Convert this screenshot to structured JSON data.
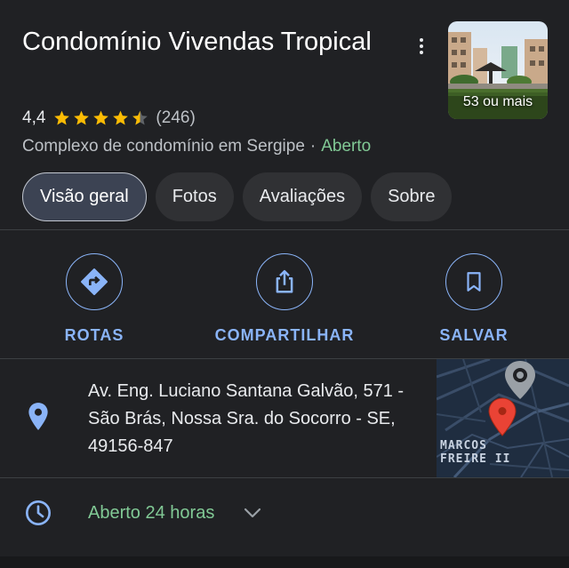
{
  "place": {
    "title": "Condomínio Vivendas Tropical",
    "rating": "4,4",
    "stars_filled": 4.4,
    "review_count": "(246)",
    "category": "Complexo de condomínio em Sergipe",
    "separator": "·",
    "status": "Aberto",
    "photo_label": "53 ou mais"
  },
  "tabs": [
    {
      "label": "Visão geral",
      "active": true
    },
    {
      "label": "Fotos",
      "active": false
    },
    {
      "label": "Avaliações",
      "active": false
    },
    {
      "label": "Sobre",
      "active": false
    }
  ],
  "actions": [
    {
      "label": "ROTAS",
      "icon": "directions-icon"
    },
    {
      "label": "COMPARTILHAR",
      "icon": "share-icon"
    },
    {
      "label": "SALVAR",
      "icon": "bookmark-icon"
    }
  ],
  "address": {
    "text": "Av. Eng. Luciano Santana Galvão, 571 - São Brás, Nossa Sra. do Socorro - SE, 49156-847",
    "map_label_line1": "MARCOS",
    "map_label_line2": "FREIRE II"
  },
  "hours": {
    "text": "Aberto 24 horas"
  },
  "colors": {
    "background": "#202124",
    "accent_blue": "#8ab4f8",
    "open_green": "#81c995",
    "star_orange": "#fbbc04",
    "pin_red": "#ea4335"
  }
}
